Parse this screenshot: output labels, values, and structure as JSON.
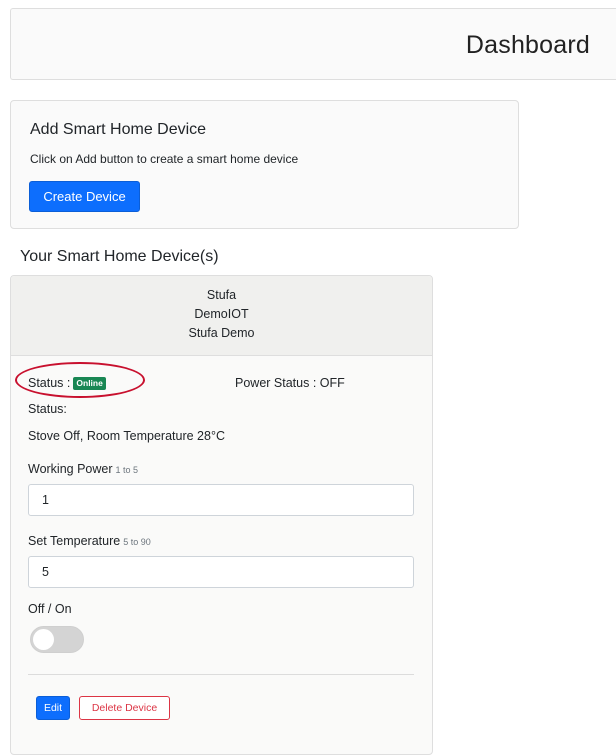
{
  "header": {
    "title": "Dashboard"
  },
  "add_device": {
    "title": "Add Smart Home Device",
    "description": "Click on Add button to create a smart home device",
    "create_button_label": "Create Device"
  },
  "devices_section": {
    "heading": "Your Smart Home Device(s)"
  },
  "device": {
    "name": "Stufa",
    "type": "DemoIOT",
    "description": "Stufa Demo",
    "status_label": "Status :",
    "status_badge": "Online",
    "power_status": "Power Status : OFF",
    "status_label_2": "Status:",
    "status_text": "Stove Off, Room Temperature 28°C",
    "working_power": {
      "label": "Working Power",
      "hint": "1 to 5",
      "value": "1"
    },
    "set_temperature": {
      "label": "Set Temperature",
      "hint": "5 to 90",
      "value": "5"
    },
    "toggle": {
      "label": "Off / On",
      "state": "off"
    },
    "edit_button_label": "Edit",
    "delete_button_label": "Delete Device"
  },
  "colors": {
    "primary": "#0d6efd",
    "online_badge": "#198754",
    "delete": "#dc3545",
    "annotation_circle": "#c8102e"
  }
}
